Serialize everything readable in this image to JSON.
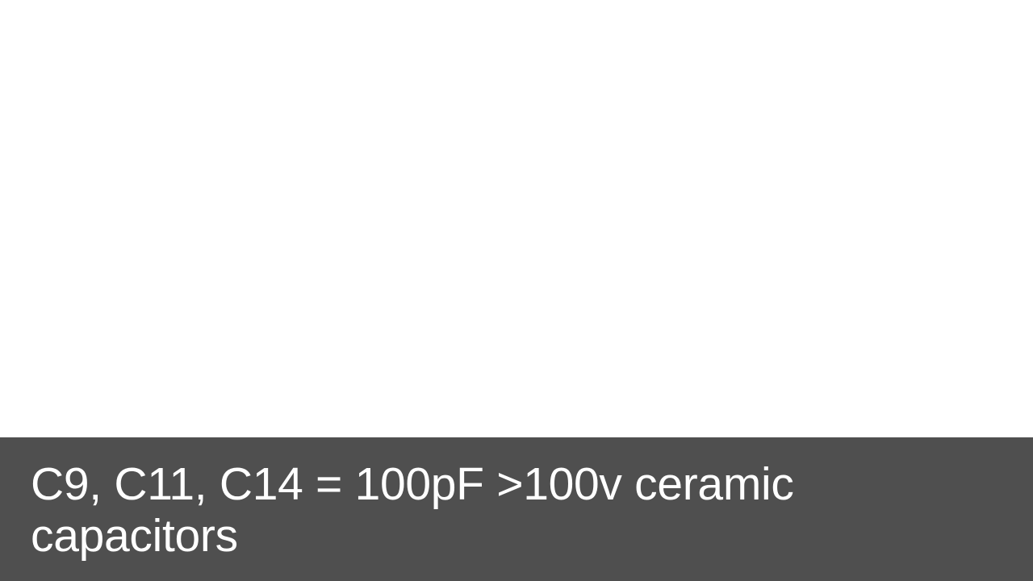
{
  "caption": {
    "text": "C9, C11, C14 = 100pF >100v ceramic capacitors",
    "background_color": "#4f4f4f",
    "text_color": "#ffffff"
  }
}
